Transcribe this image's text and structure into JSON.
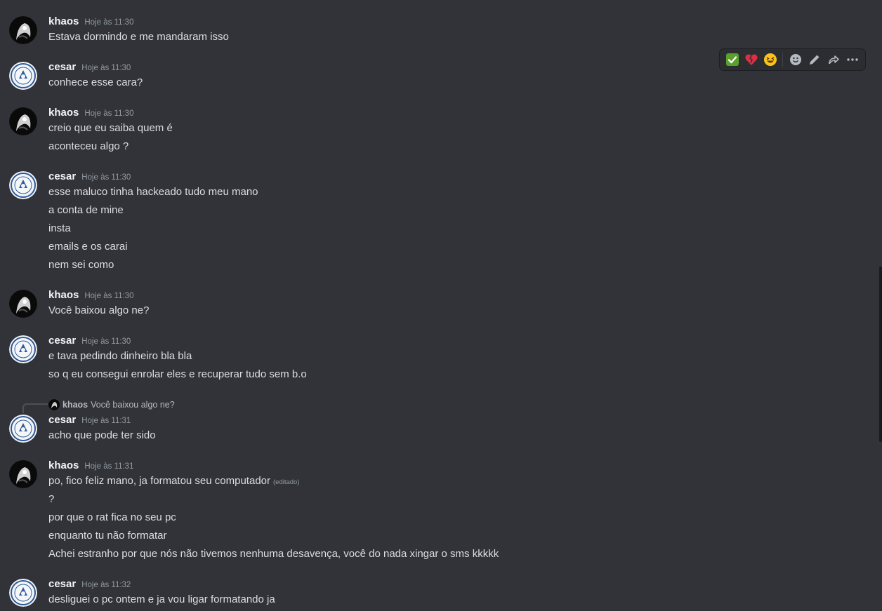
{
  "users": {
    "khaos": "khaos",
    "cesar": "cesar"
  },
  "messages": [
    {
      "user": "khaos",
      "time": "Hoje às 11:30",
      "lines": [
        "Estava dormindo e me mandaram isso"
      ]
    },
    {
      "user": "cesar",
      "time": "Hoje às 11:30",
      "lines": [
        "conhece esse cara?"
      ]
    },
    {
      "user": "khaos",
      "time": "Hoje às 11:30",
      "lines": [
        "creio que eu saiba quem é",
        "aconteceu algo ?"
      ]
    },
    {
      "user": "cesar",
      "time": "Hoje às 11:30",
      "lines": [
        "esse maluco tinha hackeado tudo meu mano",
        "a conta de mine",
        "insta",
        "emails e os carai",
        "nem sei como"
      ]
    },
    {
      "user": "khaos",
      "time": "Hoje às 11:30",
      "lines": [
        "Você baixou algo ne?"
      ]
    },
    {
      "user": "cesar",
      "time": "Hoje às 11:30",
      "lines": [
        "e tava pedindo dinheiro bla bla",
        "so q eu consegui enrolar eles e recuperar tudo sem b.o"
      ]
    },
    {
      "user": "cesar",
      "time": "Hoje às 11:31",
      "lines": [
        "acho que pode ter sido"
      ]
    },
    {
      "user": "khaos",
      "time": "Hoje às 11:31",
      "lines": [
        "po, fico feliz mano, ja formatou seu computador",
        "?",
        "por que o rat fica no seu pc",
        "enquanto tu não formatar",
        "Achei estranho por que nós não tivemos nenhuma desavença, você do nada xingar o sms kkkkk"
      ]
    },
    {
      "user": "cesar",
      "time": "Hoje às 11:32",
      "lines": [
        "desliguei o pc ontem e ja vou ligar formatando ja"
      ]
    }
  ],
  "edited_label": "(editado)",
  "reply": {
    "user": "khaos",
    "text": "Você baixou algo ne?"
  },
  "toolbar": {
    "reactions": [
      "check-mark-emoji",
      "broken-heart-emoji",
      "laughing-emoji"
    ],
    "actions": [
      "add-reaction-icon",
      "edit-icon",
      "forward-icon",
      "more-icon"
    ]
  },
  "colors": {
    "background": "#313338",
    "username": "#f2f3f5",
    "text": "#dbdee1",
    "muted": "#949ba4"
  }
}
